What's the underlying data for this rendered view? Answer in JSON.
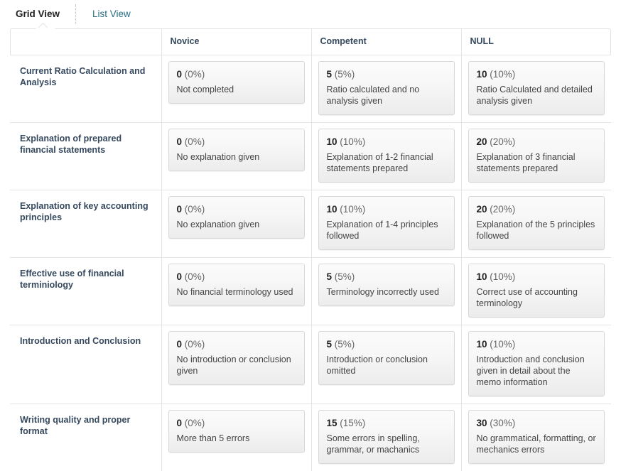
{
  "tabs": [
    {
      "label": "Grid View",
      "active": true
    },
    {
      "label": "List View",
      "active": false
    }
  ],
  "colors": {
    "tab_active_text": "#222222",
    "tab_link_text": "#286e84",
    "header_text": "#36495e",
    "criterion_text": "#36495e",
    "cell_border": "#d8d8d8",
    "table_border": "#e2e2e2",
    "cell_bg_top": "#fbfbfb",
    "cell_bg_bottom": "#ececec"
  },
  "table": {
    "criteria_header": "",
    "columns": [
      "Novice",
      "Competent",
      "NULL"
    ],
    "rows": [
      {
        "criterion": "Current Ratio Calculation and Analysis",
        "cells": [
          {
            "points": "0",
            "percent": "(0%)",
            "description": "Not completed"
          },
          {
            "points": "5",
            "percent": "(5%)",
            "description": "Ratio calculated and no analysis given"
          },
          {
            "points": "10",
            "percent": "(10%)",
            "description": "Ratio Calculated and detailed analysis given"
          }
        ]
      },
      {
        "criterion": "Explanation of prepared financial statements",
        "cells": [
          {
            "points": "0",
            "percent": "(0%)",
            "description": "No explanation given"
          },
          {
            "points": "10",
            "percent": "(10%)",
            "description": "Explanation of 1-2 financial statements prepared"
          },
          {
            "points": "20",
            "percent": "(20%)",
            "description": "Explanation of 3 financial statements prepared"
          }
        ]
      },
      {
        "criterion": "Explanation of key accounting principles",
        "cells": [
          {
            "points": "0",
            "percent": "(0%)",
            "description": "No explanation given"
          },
          {
            "points": "10",
            "percent": "(10%)",
            "description": "Explanation of 1-4 principles followed"
          },
          {
            "points": "20",
            "percent": "(20%)",
            "description": "Explanation of the 5 principles followed"
          }
        ]
      },
      {
        "criterion": "Effective use of financial terminiology",
        "cells": [
          {
            "points": "0",
            "percent": "(0%)",
            "description": "No financial terminology used"
          },
          {
            "points": "5",
            "percent": "(5%)",
            "description": "Terminology incorrectly used"
          },
          {
            "points": "10",
            "percent": "(10%)",
            "description": "Correct use of accounting terminology"
          }
        ]
      },
      {
        "criterion": "Introduction and Conclusion",
        "cells": [
          {
            "points": "0",
            "percent": "(0%)",
            "description": "No introduction or conclusion given"
          },
          {
            "points": "5",
            "percent": "(5%)",
            "description": "Introduction or conclusion omitted"
          },
          {
            "points": "10",
            "percent": "(10%)",
            "description": "Introduction and conclusion given in detail about the memo information"
          }
        ]
      },
      {
        "criterion": "Writing quality and proper format",
        "cells": [
          {
            "points": "0",
            "percent": "(0%)",
            "description": "More than 5 errors"
          },
          {
            "points": "15",
            "percent": "(15%)",
            "description": "Some errors in spelling, grammar, or machanics"
          },
          {
            "points": "30",
            "percent": "(30%)",
            "description": "No grammatical, formatting, or mechanics errors"
          }
        ]
      }
    ]
  }
}
